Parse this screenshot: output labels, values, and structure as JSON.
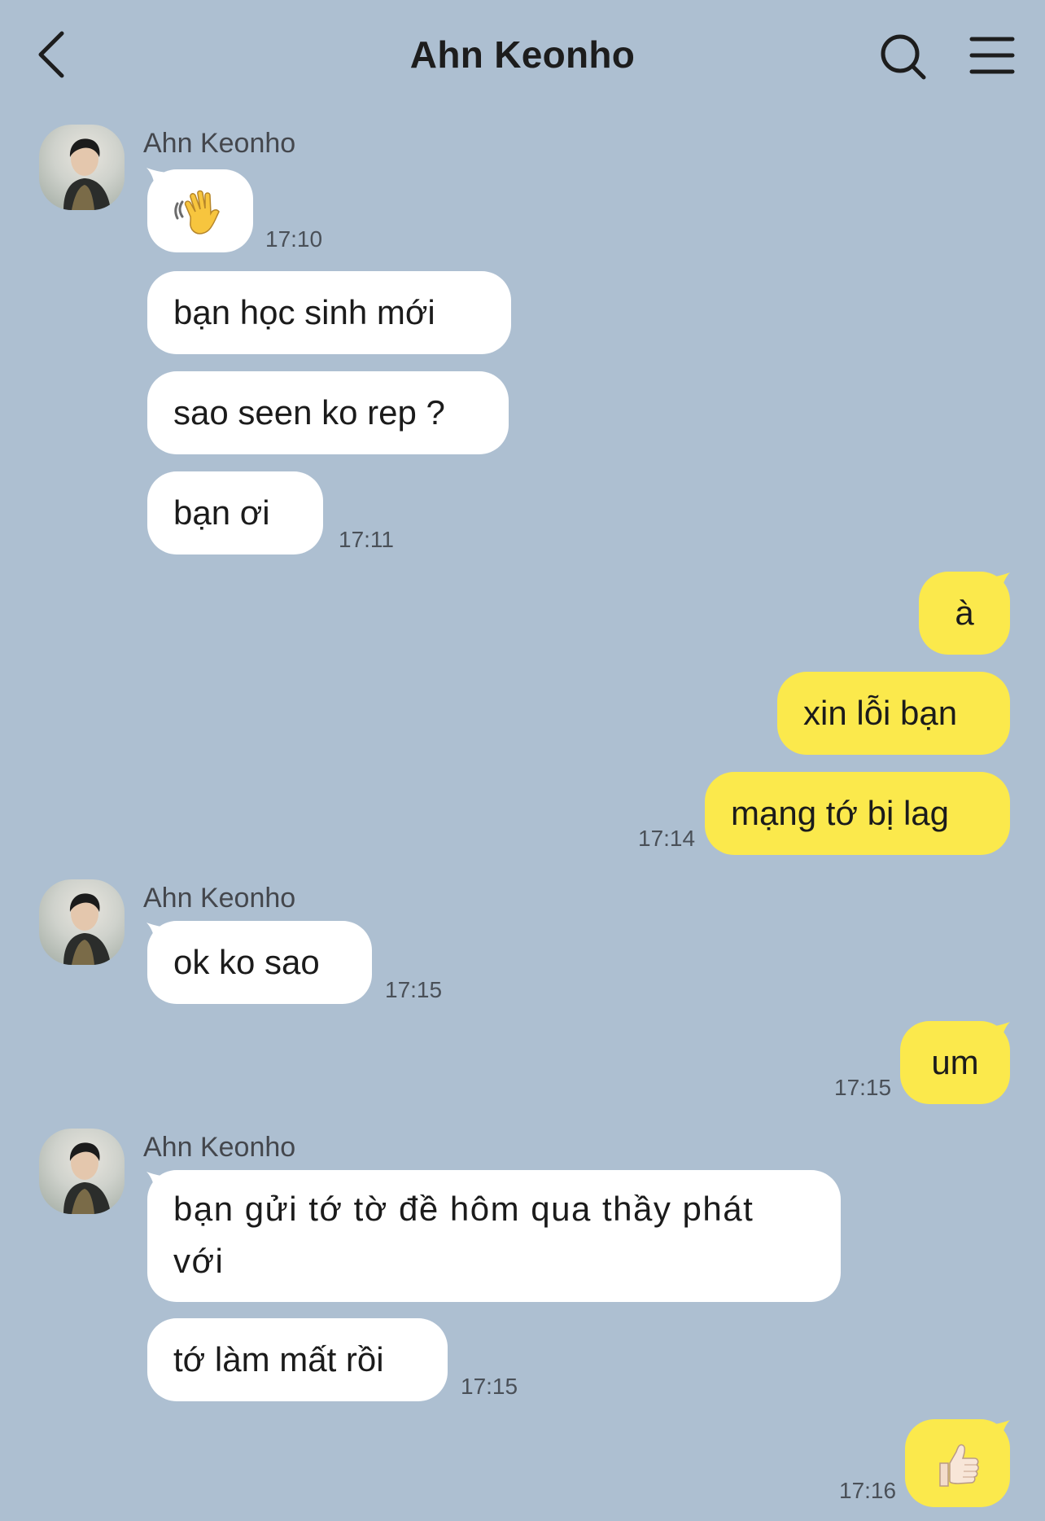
{
  "header": {
    "title": "Ahn Keonho"
  },
  "icons": {
    "back": "chevron-left-icon",
    "search": "search-icon",
    "menu": "hamburger-menu-icon",
    "wave": "waving-hand-emoji",
    "thumbs": "thumbs-up-emoji"
  },
  "colors": {
    "background": "#adbfd1",
    "incoming_bubble": "#ffffff",
    "outgoing_bubble": "#fbe94c"
  },
  "messages": {
    "group1": {
      "sender": "Ahn Keonho",
      "wave_time": "17:10",
      "m2": "bạn học sinh mới",
      "m3": "sao seen ko rep ?",
      "m4": "bạn ơi",
      "time": "17:11"
    },
    "group2": {
      "m1": "à",
      "m2": "xin lỗi bạn",
      "m3": "mạng tớ bị lag",
      "time": "17:14"
    },
    "group3": {
      "sender": "Ahn Keonho",
      "m1": "ok ko sao",
      "time": "17:15"
    },
    "group4": {
      "m1": "um",
      "time": "17:15"
    },
    "group5": {
      "sender": "Ahn Keonho",
      "m1": "bạn gửi tớ tờ đề hôm qua thầy phát với",
      "m2": "tớ làm mất rồi",
      "time": "17:15"
    },
    "group6": {
      "time": "17:16"
    }
  }
}
